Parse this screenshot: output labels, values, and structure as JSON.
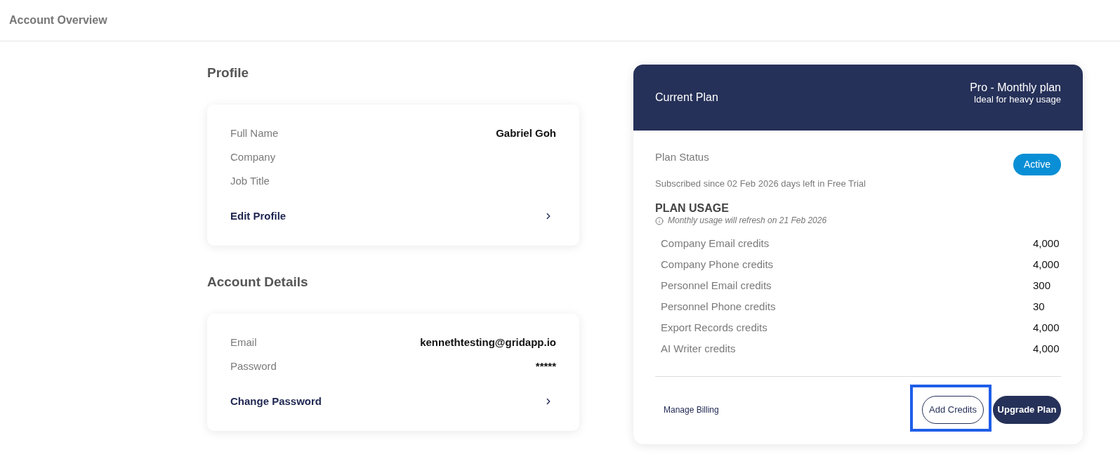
{
  "header": {
    "title": "Account Overview"
  },
  "profile": {
    "heading": "Profile",
    "fields": [
      {
        "label": "Full Name",
        "value": "Gabriel Goh"
      },
      {
        "label": "Company"
      },
      {
        "label": "Job Title"
      }
    ],
    "link": "Edit Profile"
  },
  "account_details": {
    "heading": "Account Details",
    "fields": [
      {
        "label": "Email",
        "value": "kennethtesting@gridapp.io"
      },
      {
        "label": "Password",
        "value": "*****"
      }
    ],
    "link": "Change Password"
  },
  "current_plan": {
    "title": "Current Plan",
    "plan_name": "Pro - Monthly plan",
    "plan_tagline": "Ideal for heavy usage",
    "status_label": "Plan Status",
    "status": "Active",
    "subscription_note": "Subscribed since 02 Feb 2026 days left in Free Trial",
    "usage_heading": "PLAN USAGE",
    "usage_note": "Monthly usage will refresh on 21 Feb 2026",
    "credits": [
      {
        "label": "Company Email credits",
        "value": "4,000"
      },
      {
        "label": "Company Phone credits",
        "value": "4,000"
      },
      {
        "label": "Personnel Email credits",
        "value": "300"
      },
      {
        "label": "Personnel Phone credits",
        "value": "30"
      },
      {
        "label": "Export Records credits",
        "value": "4,000"
      },
      {
        "label": "AI Writer credits",
        "value": "4,000"
      }
    ],
    "manage_billing": "Manage Billing",
    "buttons": [
      {
        "label": "Add Credits",
        "kind": "outline",
        "highlighted": true
      },
      {
        "label": "Upgrade Plan",
        "kind": "filled",
        "highlighted": false
      }
    ]
  }
}
